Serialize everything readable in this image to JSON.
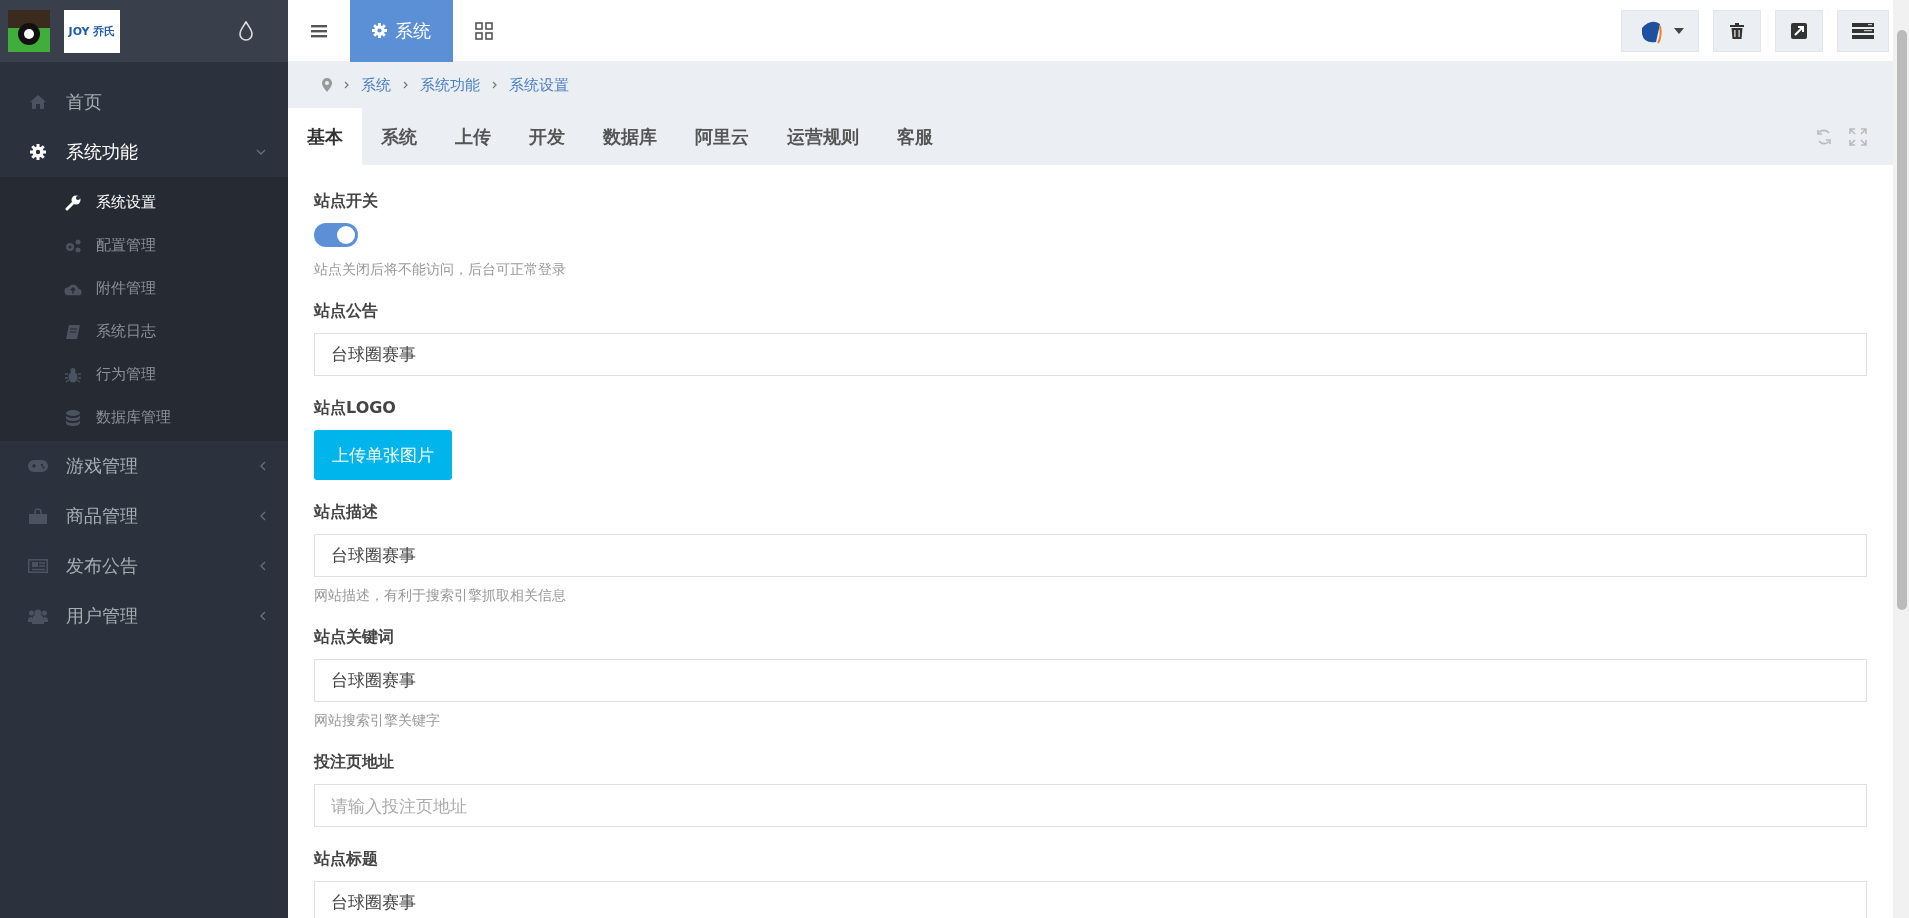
{
  "sidebar": {
    "logo_text": "JOY 乔氏",
    "menu": [
      {
        "label": "首页",
        "expanded": false
      },
      {
        "label": "系统功能",
        "expanded": true,
        "children": [
          {
            "label": "系统设置",
            "selected": true
          },
          {
            "label": "配置管理",
            "selected": false
          },
          {
            "label": "附件管理",
            "selected": false
          },
          {
            "label": "系统日志",
            "selected": false
          },
          {
            "label": "行为管理",
            "selected": false
          },
          {
            "label": "数据库管理",
            "selected": false
          }
        ]
      },
      {
        "label": "游戏管理",
        "expanded": false
      },
      {
        "label": "商品管理",
        "expanded": false
      },
      {
        "label": "发布公告",
        "expanded": false
      },
      {
        "label": "用户管理",
        "expanded": false
      }
    ]
  },
  "topbar": {
    "tabs": [
      {
        "label": "系统",
        "selected": true
      }
    ]
  },
  "breadcrumb": [
    "系统",
    "系统功能",
    "系统设置"
  ],
  "tabs": [
    {
      "label": "基本",
      "selected": true
    },
    {
      "label": "系统",
      "selected": false
    },
    {
      "label": "上传",
      "selected": false
    },
    {
      "label": "开发",
      "selected": false
    },
    {
      "label": "数据库",
      "selected": false
    },
    {
      "label": "阿里云",
      "selected": false
    },
    {
      "label": "运营规则",
      "selected": false
    },
    {
      "label": "客服",
      "selected": false
    }
  ],
  "fields": [
    {
      "kind": "toggle",
      "label": "站点开关",
      "on": true,
      "help": "站点关闭后将不能访问，后台可正常登录"
    },
    {
      "kind": "text",
      "label": "站点公告",
      "value": "台球圈赛事"
    },
    {
      "kind": "upload",
      "label": "站点LOGO",
      "button": "上传单张图片"
    },
    {
      "kind": "text",
      "label": "站点描述",
      "value": "台球圈赛事",
      "help": "网站描述，有利于搜索引擎抓取相关信息"
    },
    {
      "kind": "text",
      "label": "站点关键词",
      "value": "台球圈赛事",
      "help": "网站搜索引擎关键字"
    },
    {
      "kind": "text",
      "label": "投注页地址",
      "placeholder": "请输入投注页地址"
    },
    {
      "kind": "text",
      "label": "站点标题",
      "value": "台球圈赛事"
    }
  ]
}
